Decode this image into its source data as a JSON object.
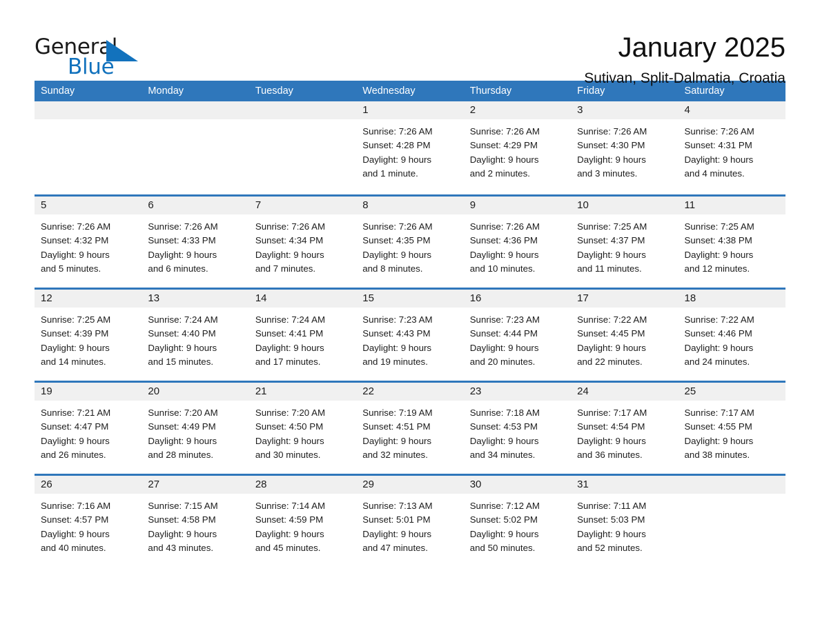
{
  "brand": {
    "name_part1": "General",
    "name_part2": "Blue",
    "triangle_color": "#1272bd",
    "logo_icon": "triangle-logo-icon"
  },
  "header": {
    "title": "January 2025",
    "subtitle": "Sutivan, Split-Dalmatia, Croatia"
  },
  "colors": {
    "header_blue": "#2f77bb",
    "day_band_gray": "#f0f0f0",
    "brand_blue": "#1272bd",
    "text": "#1c1c1c"
  },
  "weekdays": [
    "Sunday",
    "Monday",
    "Tuesday",
    "Wednesday",
    "Thursday",
    "Friday",
    "Saturday"
  ],
  "weeks": [
    [
      {
        "day": "",
        "lines": []
      },
      {
        "day": "",
        "lines": []
      },
      {
        "day": "",
        "lines": []
      },
      {
        "day": "1",
        "lines": [
          "Sunrise: 7:26 AM",
          "Sunset: 4:28 PM",
          "Daylight: 9 hours",
          "and 1 minute."
        ]
      },
      {
        "day": "2",
        "lines": [
          "Sunrise: 7:26 AM",
          "Sunset: 4:29 PM",
          "Daylight: 9 hours",
          "and 2 minutes."
        ]
      },
      {
        "day": "3",
        "lines": [
          "Sunrise: 7:26 AM",
          "Sunset: 4:30 PM",
          "Daylight: 9 hours",
          "and 3 minutes."
        ]
      },
      {
        "day": "4",
        "lines": [
          "Sunrise: 7:26 AM",
          "Sunset: 4:31 PM",
          "Daylight: 9 hours",
          "and 4 minutes."
        ]
      }
    ],
    [
      {
        "day": "5",
        "lines": [
          "Sunrise: 7:26 AM",
          "Sunset: 4:32 PM",
          "Daylight: 9 hours",
          "and 5 minutes."
        ]
      },
      {
        "day": "6",
        "lines": [
          "Sunrise: 7:26 AM",
          "Sunset: 4:33 PM",
          "Daylight: 9 hours",
          "and 6 minutes."
        ]
      },
      {
        "day": "7",
        "lines": [
          "Sunrise: 7:26 AM",
          "Sunset: 4:34 PM",
          "Daylight: 9 hours",
          "and 7 minutes."
        ]
      },
      {
        "day": "8",
        "lines": [
          "Sunrise: 7:26 AM",
          "Sunset: 4:35 PM",
          "Daylight: 9 hours",
          "and 8 minutes."
        ]
      },
      {
        "day": "9",
        "lines": [
          "Sunrise: 7:26 AM",
          "Sunset: 4:36 PM",
          "Daylight: 9 hours",
          "and 10 minutes."
        ]
      },
      {
        "day": "10",
        "lines": [
          "Sunrise: 7:25 AM",
          "Sunset: 4:37 PM",
          "Daylight: 9 hours",
          "and 11 minutes."
        ]
      },
      {
        "day": "11",
        "lines": [
          "Sunrise: 7:25 AM",
          "Sunset: 4:38 PM",
          "Daylight: 9 hours",
          "and 12 minutes."
        ]
      }
    ],
    [
      {
        "day": "12",
        "lines": [
          "Sunrise: 7:25 AM",
          "Sunset: 4:39 PM",
          "Daylight: 9 hours",
          "and 14 minutes."
        ]
      },
      {
        "day": "13",
        "lines": [
          "Sunrise: 7:24 AM",
          "Sunset: 4:40 PM",
          "Daylight: 9 hours",
          "and 15 minutes."
        ]
      },
      {
        "day": "14",
        "lines": [
          "Sunrise: 7:24 AM",
          "Sunset: 4:41 PM",
          "Daylight: 9 hours",
          "and 17 minutes."
        ]
      },
      {
        "day": "15",
        "lines": [
          "Sunrise: 7:23 AM",
          "Sunset: 4:43 PM",
          "Daylight: 9 hours",
          "and 19 minutes."
        ]
      },
      {
        "day": "16",
        "lines": [
          "Sunrise: 7:23 AM",
          "Sunset: 4:44 PM",
          "Daylight: 9 hours",
          "and 20 minutes."
        ]
      },
      {
        "day": "17",
        "lines": [
          "Sunrise: 7:22 AM",
          "Sunset: 4:45 PM",
          "Daylight: 9 hours",
          "and 22 minutes."
        ]
      },
      {
        "day": "18",
        "lines": [
          "Sunrise: 7:22 AM",
          "Sunset: 4:46 PM",
          "Daylight: 9 hours",
          "and 24 minutes."
        ]
      }
    ],
    [
      {
        "day": "19",
        "lines": [
          "Sunrise: 7:21 AM",
          "Sunset: 4:47 PM",
          "Daylight: 9 hours",
          "and 26 minutes."
        ]
      },
      {
        "day": "20",
        "lines": [
          "Sunrise: 7:20 AM",
          "Sunset: 4:49 PM",
          "Daylight: 9 hours",
          "and 28 minutes."
        ]
      },
      {
        "day": "21",
        "lines": [
          "Sunrise: 7:20 AM",
          "Sunset: 4:50 PM",
          "Daylight: 9 hours",
          "and 30 minutes."
        ]
      },
      {
        "day": "22",
        "lines": [
          "Sunrise: 7:19 AM",
          "Sunset: 4:51 PM",
          "Daylight: 9 hours",
          "and 32 minutes."
        ]
      },
      {
        "day": "23",
        "lines": [
          "Sunrise: 7:18 AM",
          "Sunset: 4:53 PM",
          "Daylight: 9 hours",
          "and 34 minutes."
        ]
      },
      {
        "day": "24",
        "lines": [
          "Sunrise: 7:17 AM",
          "Sunset: 4:54 PM",
          "Daylight: 9 hours",
          "and 36 minutes."
        ]
      },
      {
        "day": "25",
        "lines": [
          "Sunrise: 7:17 AM",
          "Sunset: 4:55 PM",
          "Daylight: 9 hours",
          "and 38 minutes."
        ]
      }
    ],
    [
      {
        "day": "26",
        "lines": [
          "Sunrise: 7:16 AM",
          "Sunset: 4:57 PM",
          "Daylight: 9 hours",
          "and 40 minutes."
        ]
      },
      {
        "day": "27",
        "lines": [
          "Sunrise: 7:15 AM",
          "Sunset: 4:58 PM",
          "Daylight: 9 hours",
          "and 43 minutes."
        ]
      },
      {
        "day": "28",
        "lines": [
          "Sunrise: 7:14 AM",
          "Sunset: 4:59 PM",
          "Daylight: 9 hours",
          "and 45 minutes."
        ]
      },
      {
        "day": "29",
        "lines": [
          "Sunrise: 7:13 AM",
          "Sunset: 5:01 PM",
          "Daylight: 9 hours",
          "and 47 minutes."
        ]
      },
      {
        "day": "30",
        "lines": [
          "Sunrise: 7:12 AM",
          "Sunset: 5:02 PM",
          "Daylight: 9 hours",
          "and 50 minutes."
        ]
      },
      {
        "day": "31",
        "lines": [
          "Sunrise: 7:11 AM",
          "Sunset: 5:03 PM",
          "Daylight: 9 hours",
          "and 52 minutes."
        ]
      },
      {
        "day": "",
        "lines": []
      }
    ]
  ]
}
